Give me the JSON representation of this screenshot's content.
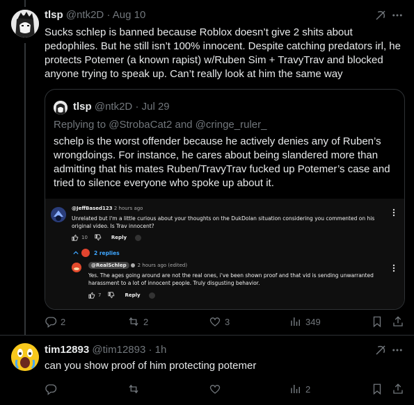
{
  "colors": {
    "background": "#000000",
    "text": "#e7e9ea",
    "muted": "#71767b",
    "border": "#2f3336",
    "link_blue": "#3ea6ff"
  },
  "post1": {
    "display_name": "tlsp",
    "handle": "@ntk2D",
    "separator": "·",
    "date": "Aug 10",
    "text": "Sucks schlep is banned because Roblox doesn’t give 2 shits about pedophiles. But he still isn’t 100% innocent. Despite catching predators irl, he protects Potemer (a known rapist) w/Ruben Sim + TravyTrav and blocked anyone trying to speak up. Can’t really look at him the same way",
    "quote": {
      "display_name": "tlsp",
      "handle": "@ntk2D",
      "separator": "·",
      "date": "Jul 29",
      "replying_to": "Replying to @StrobaCat2 and @cringe_ruler_",
      "text": "schelp is the worst offender because he actively denies any of Ruben’s wrongdoings. For instance, he cares about being slandered more than admitting that his mates Ruben/TravyTrav fucked up Potemer’s case and tried to silence everyone who spoke up about it.",
      "embedded_comment": {
        "author": "@JeffBased123",
        "time": "2 hours ago",
        "text": "Unrelated but I'm a little curious about your thoughts on the DukDolan situation considering you commented on his original video. Is Trav innocent?",
        "likes": "10",
        "reply_label": "Reply",
        "replies_count": "2 replies",
        "reply": {
          "author": "@RealSchlep",
          "time": "2 hours ago (edited)",
          "text": "Yes. The ages going around are not the real ones, i've been shown proof and that vid is sending unwarranted harassment to a lot of innocent people. Truly disgusting behavior.",
          "likes": "7",
          "reply_label": "Reply"
        }
      }
    },
    "actions": {
      "replies": "2",
      "reposts": "2",
      "likes": "3",
      "views": "349"
    }
  },
  "post2": {
    "display_name": "tim12893",
    "handle": "@tim12893",
    "separator": "·",
    "date": "1h",
    "text": "can you show proof of him protecting potemer",
    "actions": {
      "replies": "",
      "reposts": "",
      "likes": "",
      "views": "2"
    }
  }
}
